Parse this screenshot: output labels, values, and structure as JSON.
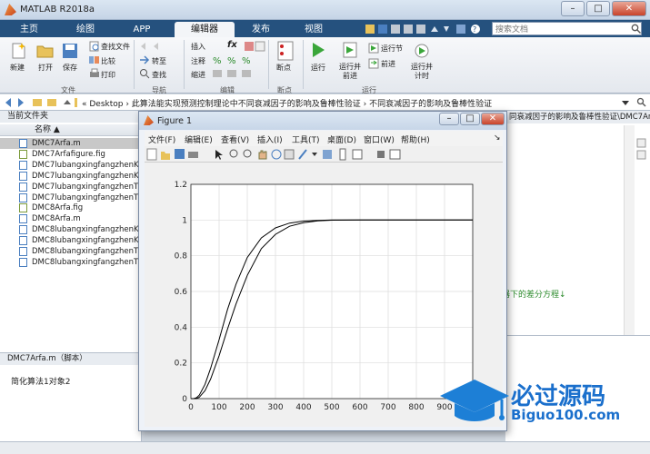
{
  "window": {
    "title": "MATLAB R2018a",
    "min": "–",
    "max": "□",
    "close": "✕"
  },
  "tabs": [
    "主页",
    "绘图",
    "APP",
    "编辑器",
    "发布",
    "视图"
  ],
  "active_tab_index": 3,
  "search": {
    "placeholder": "搜索文档"
  },
  "ribbon": {
    "file_group": {
      "label": "文件",
      "new": "新建",
      "open": "打开",
      "save": "保存",
      "find_files": "查找文件",
      "compare": "比较",
      "print": "打印"
    },
    "nav_group": {
      "label": "导航",
      "goto": "转至",
      "find": "查找"
    },
    "edit_group": {
      "label": "编辑",
      "insert": "插入",
      "comment": "注释",
      "indent": "缩进",
      "fx": "fx"
    },
    "breakpoint_group": {
      "label": "断点",
      "breakpoints": "断点"
    },
    "run_group": {
      "label": "运行",
      "run": "运行",
      "run_advance": "运行并\n前进",
      "run_section": "运行节",
      "advance": "前进",
      "run_time": "运行并\n计时"
    }
  },
  "address": {
    "path": "« Desktop › 此算法能实现预测控制理论中不同衰减因子的影响及鲁棒性验证 › 不同衰减因子的影响及鲁棒性验证"
  },
  "current_folder": {
    "title": "当前文件夹",
    "column_name": "名称 ▲",
    "files": [
      "DMC7Arfa.m",
      "DMC7Arfafigure.fig",
      "DMC7lubangxingfangzhenK...",
      "DMC7lubangxingfangzhenKf...",
      "DMC7lubangxingfangzhenT...",
      "DMC7lubangxingfangzhenTf...",
      "DMC8Arfa.fig",
      "DMC8Arfa.m",
      "DMC8lubangxingfangzhenK...",
      "DMC8lubangxingfangzhenKf...",
      "DMC8lubangxingfangzhenT...",
      "DMC8lubangxingfangzhenTf..."
    ],
    "selected_index": 0
  },
  "details": {
    "header": "DMC7Arfa.m（脚本）",
    "text": "简化算法1对象2"
  },
  "editor_right": {
    "tab_text": "同衰减因子的影响及鲁棒性验证\\DMC7Arfa.m",
    "snippet": "器下的差分方程↓"
  },
  "figure": {
    "title": "Figure 1",
    "menu": [
      "文件(F)",
      "编辑(E)",
      "查看(V)",
      "插入(I)",
      "工具(T)",
      "桌面(D)",
      "窗口(W)",
      "帮助(H)"
    ],
    "menu_arrow": "↘"
  },
  "chart_data": {
    "type": "line",
    "title": "",
    "xlabel": "",
    "ylabel": "",
    "xlim": [
      0,
      1000
    ],
    "ylim": [
      0,
      1.2
    ],
    "xticks": [
      0,
      100,
      200,
      300,
      400,
      500,
      600,
      700,
      800,
      900
    ],
    "yticks": [
      0,
      0.2,
      0.4,
      0.6,
      0.8,
      1,
      1.2
    ],
    "ytick_labels": [
      "0",
      "0.2",
      "0.4",
      "0.6",
      "0.8",
      "1",
      "1.2"
    ],
    "grid": true,
    "series": [
      {
        "x": [
          0,
          10,
          20,
          30,
          50,
          70,
          100,
          130,
          160,
          200,
          250,
          300,
          350,
          400,
          450,
          500,
          600,
          700,
          800,
          900,
          1000
        ],
        "values": [
          0,
          0,
          0.005,
          0.02,
          0.08,
          0.17,
          0.33,
          0.5,
          0.64,
          0.79,
          0.9,
          0.956,
          0.983,
          0.994,
          0.998,
          1,
          1,
          1,
          1,
          1,
          1
        ]
      },
      {
        "x": [
          0,
          10,
          20,
          30,
          50,
          70,
          100,
          130,
          160,
          200,
          250,
          300,
          350,
          400,
          450,
          500,
          600,
          700,
          800,
          900,
          1000
        ],
        "values": [
          0,
          0,
          0,
          0.008,
          0.045,
          0.11,
          0.24,
          0.39,
          0.53,
          0.69,
          0.84,
          0.92,
          0.965,
          0.985,
          0.995,
          0.999,
          1,
          1,
          1,
          1,
          1
        ]
      }
    ],
    "line_color": "#000000"
  },
  "watermark": {
    "brand": "必过源码",
    "url": "Biguo100.com"
  }
}
